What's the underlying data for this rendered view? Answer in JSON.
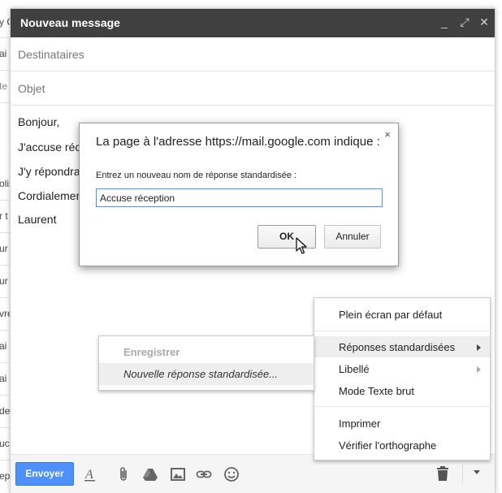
{
  "background": {
    "fragments": [
      "y C",
      "ai",
      "te",
      "olis",
      "r t",
      "ur",
      "ur",
      "vre",
      "ai",
      "ai",
      "de",
      "uci",
      "ep"
    ]
  },
  "compose": {
    "title": "Nouveau message",
    "controls": {
      "minimize": "_",
      "expand": "⤢",
      "close": "✕"
    },
    "to_placeholder": "Destinataires",
    "subject_placeholder": "Objet",
    "body_lines": [
      "Bonjour,",
      "J'accuse réce",
      "J'y répondrai",
      "Cordialement",
      "Laurent"
    ],
    "send_label": "Envoyer",
    "accent": "#4d90fe",
    "titlebar_color": "#404040"
  },
  "dialog": {
    "title": "La page à l'adresse https://mail.google.com indique :",
    "close": "×",
    "message": "Entrez un nouveau nom de réponse standardisée :",
    "input_value": "Accuse réception",
    "ok_label": "OK",
    "cancel_label": "Annuler"
  },
  "menu": {
    "items": [
      {
        "label": "Plein écran par défaut"
      },
      {
        "label": "Réponses standardisées",
        "submenu": true,
        "highlighted": true
      },
      {
        "label": "Libellé",
        "submenu": true
      },
      {
        "label": "Mode Texte brut"
      },
      {
        "label": "Imprimer"
      },
      {
        "label": "Vérifier l'orthographe"
      }
    ]
  },
  "submenu": {
    "items": [
      {
        "label": "Enregistrer",
        "disabled": true
      },
      {
        "label": "Nouvelle réponse standardisée...",
        "highlighted": true
      }
    ]
  }
}
